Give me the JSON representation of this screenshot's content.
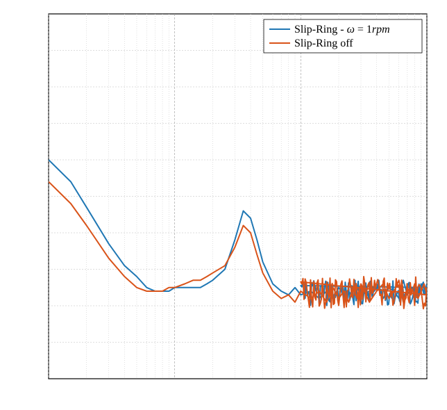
{
  "chart_data": {
    "type": "line",
    "title": "",
    "xlabel": "",
    "ylabel": "",
    "xlim": [
      1,
      1000
    ],
    "ylim": [
      0,
      1
    ],
    "xscale": "log",
    "yscale": "linear",
    "grid": true,
    "legend_position": "top-right",
    "series": [
      {
        "name": "Slip-Ring - ω = 1rpm",
        "color": "#1f77b4",
        "x": [
          1,
          1.5,
          2,
          3,
          4,
          5,
          6,
          7,
          8,
          9,
          10,
          12,
          14,
          16,
          18,
          20,
          25,
          30,
          35,
          40,
          45,
          50,
          60,
          70,
          80,
          90,
          100,
          120,
          140,
          160,
          180,
          200,
          220,
          240,
          260,
          280,
          300,
          350,
          400,
          450,
          500,
          550,
          600,
          650,
          700,
          750,
          800,
          850,
          900,
          950,
          1000
        ],
        "y": [
          0.6,
          0.54,
          0.47,
          0.37,
          0.31,
          0.28,
          0.25,
          0.24,
          0.24,
          0.24,
          0.25,
          0.25,
          0.25,
          0.25,
          0.26,
          0.27,
          0.3,
          0.38,
          0.46,
          0.44,
          0.38,
          0.32,
          0.26,
          0.24,
          0.23,
          0.25,
          0.23,
          0.24,
          0.22,
          0.24,
          0.22,
          0.25,
          0.23,
          0.24,
          0.22,
          0.25,
          0.23,
          0.24,
          0.26,
          0.22,
          0.25,
          0.24,
          0.22,
          0.27,
          0.23,
          0.25,
          0.24,
          0.22,
          0.26,
          0.23,
          0.25
        ]
      },
      {
        "name": "Slip-Ring off",
        "color": "#d95319",
        "x": [
          1,
          1.5,
          2,
          3,
          4,
          5,
          6,
          7,
          8,
          9,
          10,
          12,
          14,
          16,
          18,
          20,
          25,
          30,
          35,
          40,
          45,
          50,
          60,
          70,
          80,
          90,
          100,
          120,
          140,
          160,
          180,
          200,
          220,
          240,
          260,
          280,
          300,
          350,
          400,
          450,
          500,
          550,
          600,
          650,
          700,
          750,
          800,
          850,
          900,
          950,
          1000
        ],
        "y": [
          0.54,
          0.48,
          0.42,
          0.33,
          0.28,
          0.25,
          0.24,
          0.24,
          0.24,
          0.25,
          0.25,
          0.26,
          0.27,
          0.27,
          0.28,
          0.29,
          0.31,
          0.36,
          0.42,
          0.4,
          0.34,
          0.29,
          0.24,
          0.22,
          0.23,
          0.21,
          0.24,
          0.22,
          0.24,
          0.21,
          0.25,
          0.22,
          0.24,
          0.21,
          0.25,
          0.22,
          0.26,
          0.21,
          0.24,
          0.26,
          0.22,
          0.24,
          0.27,
          0.21,
          0.25,
          0.23,
          0.26,
          0.22,
          0.24,
          0.26,
          0.23
        ]
      }
    ]
  },
  "legend": {
    "items": [
      "Slip-Ring - ω = 1rpm",
      "Slip-Ring off"
    ]
  }
}
